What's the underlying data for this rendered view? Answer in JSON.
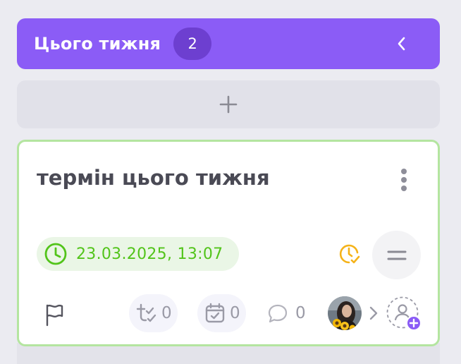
{
  "column": {
    "title": "Цього тижня",
    "count": "2",
    "accent_color": "#8b5cf6",
    "badge_color": "#6d3fd0"
  },
  "add_task": {
    "icon": "plus-icon"
  },
  "task_card": {
    "title": "термін цього тижня",
    "border_color": "#b4e5a0",
    "due_date": "23.03.2025, 13:07",
    "due_color": "#52c41a",
    "timer_icon_color": "#f5b31a",
    "subtasks_count": "0",
    "checklists_count": "0",
    "comments_count": "0",
    "icons": {
      "more": "more-vertical-icon",
      "clock": "clock-icon",
      "timer": "clock-check-icon",
      "priority": "equals-icon",
      "flag": "flag-icon",
      "subtasks": "subtasks-icon",
      "checklist": "calendar-check-icon",
      "comments": "comment-icon",
      "expand_assignees": "chevron-right-icon",
      "add_assignee": "add-user-icon"
    }
  }
}
